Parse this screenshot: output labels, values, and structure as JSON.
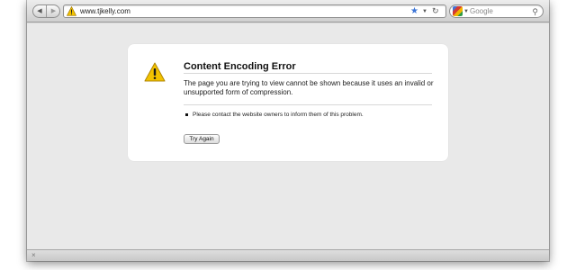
{
  "toolbar": {
    "back_icon": "back-arrow-icon",
    "forward_icon": "forward-arrow-icon",
    "url": "www.tjkelly.com",
    "search_placeholder": "Google",
    "accent": "#3b74d6"
  },
  "error_page": {
    "title": "Content Encoding Error",
    "description": "The page you are trying to view cannot be shown because it uses an invalid or unsupported form of compression.",
    "suggestion": "Please contact the website owners to inform them of this problem.",
    "retry_label": "Try Again",
    "warning_color": "#f2c200"
  },
  "statusbar": {
    "close_icon": "close-icon"
  }
}
